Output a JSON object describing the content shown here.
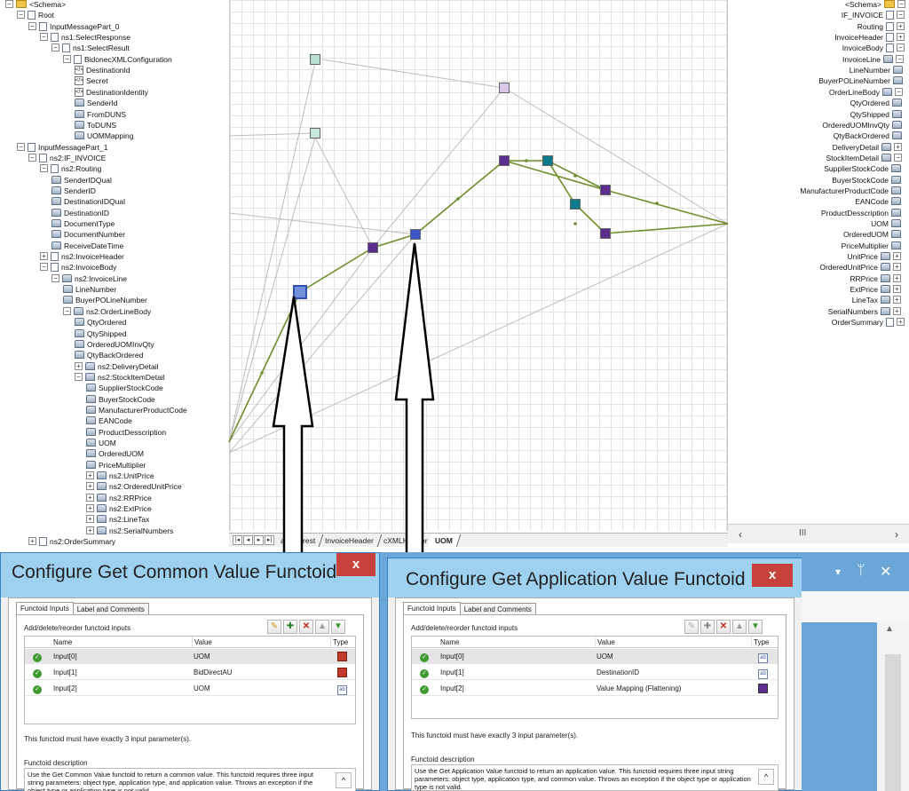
{
  "mapper": {
    "source_tree": [
      {
        "label": "<Schema>",
        "icon": "folder-icon",
        "exp": "−"
      },
      {
        "label": "Root",
        "icon": "record-icon",
        "exp": "−"
      },
      {
        "label": "InputMessagePart_0",
        "icon": "record-icon",
        "exp": "−"
      },
      {
        "label": "ns1:SelectResponse",
        "icon": "record-icon",
        "exp": "−"
      },
      {
        "label": "ns1:SelectResult",
        "icon": "record-icon",
        "exp": "−"
      },
      {
        "label": "BidonecXMLConfiguration",
        "icon": "record-icon",
        "exp": "−"
      },
      {
        "label": "DestinationId",
        "icon": "attribute-icon",
        "exp": ""
      },
      {
        "label": "Secret",
        "icon": "attribute-icon",
        "exp": ""
      },
      {
        "label": "DestinationIdentity",
        "icon": "attribute-icon",
        "exp": ""
      },
      {
        "label": "SenderId",
        "icon": "element-icon",
        "exp": ""
      },
      {
        "label": "FromDUNS",
        "icon": "element-icon",
        "exp": ""
      },
      {
        "label": "ToDUNS",
        "icon": "element-icon",
        "exp": ""
      },
      {
        "label": "UOMMapping",
        "icon": "element-icon",
        "exp": ""
      },
      {
        "label": "InputMessagePart_1",
        "icon": "record-icon",
        "exp": "−"
      },
      {
        "label": "ns2:IF_INVOICE",
        "icon": "record-icon",
        "exp": "−"
      },
      {
        "label": "ns2:Routing",
        "icon": "record-icon",
        "exp": "−"
      },
      {
        "label": "SenderIDQual",
        "icon": "element-icon",
        "exp": ""
      },
      {
        "label": "SenderID",
        "icon": "element-icon",
        "exp": ""
      },
      {
        "label": "DestinationIDQual",
        "icon": "element-icon",
        "exp": ""
      },
      {
        "label": "DestinationID",
        "icon": "element-icon",
        "exp": ""
      },
      {
        "label": "DocumentType",
        "icon": "element-icon",
        "exp": ""
      },
      {
        "label": "DocumentNumber",
        "icon": "element-icon",
        "exp": ""
      },
      {
        "label": "ReceiveDateTime",
        "icon": "element-icon",
        "exp": ""
      },
      {
        "label": "ns2:InvoiceHeader",
        "icon": "record-icon",
        "exp": "+"
      },
      {
        "label": "ns2:InvoiceBody",
        "icon": "record-icon",
        "exp": "−"
      },
      {
        "label": "ns2:InvoiceLine",
        "icon": "element-icon",
        "exp": "−"
      },
      {
        "label": "LineNumber",
        "icon": "element-icon",
        "exp": ""
      },
      {
        "label": "BuyerPOLineNumber",
        "icon": "element-icon",
        "exp": ""
      },
      {
        "label": "ns2:OrderLineBody",
        "icon": "element-icon",
        "exp": "−"
      },
      {
        "label": "QtyOrdered",
        "icon": "element-icon",
        "exp": ""
      },
      {
        "label": "QtyShipped",
        "icon": "element-icon",
        "exp": ""
      },
      {
        "label": "OrderedUOMInvQty",
        "icon": "element-icon",
        "exp": ""
      },
      {
        "label": "QtyBackOrdered",
        "icon": "element-icon",
        "exp": ""
      },
      {
        "label": "ns2:DeliveryDetail",
        "icon": "element-icon",
        "exp": "+"
      },
      {
        "label": "ns2:StockItemDetail",
        "icon": "element-icon",
        "exp": "−"
      },
      {
        "label": "SupplierStockCode",
        "icon": "element-icon",
        "exp": ""
      },
      {
        "label": "BuyerStockCode",
        "icon": "element-icon",
        "exp": ""
      },
      {
        "label": "ManufacturerProductCode",
        "icon": "element-icon",
        "exp": ""
      },
      {
        "label": "EANCode",
        "icon": "element-icon",
        "exp": ""
      },
      {
        "label": "ProductDesscription",
        "icon": "element-icon",
        "exp": ""
      },
      {
        "label": "UOM",
        "icon": "element-icon",
        "exp": ""
      },
      {
        "label": "OrderedUOM",
        "icon": "element-icon",
        "exp": ""
      },
      {
        "label": "PriceMultiplier",
        "icon": "element-icon",
        "exp": ""
      },
      {
        "label": "ns2:UnitPrice",
        "icon": "element-icon",
        "exp": "+"
      },
      {
        "label": "ns2:OrderedUnitPrice",
        "icon": "element-icon",
        "exp": "+"
      },
      {
        "label": "ns2:RRPrice",
        "icon": "element-icon",
        "exp": "+"
      },
      {
        "label": "ns2:ExtPrice",
        "icon": "element-icon",
        "exp": "+"
      },
      {
        "label": "ns2:LineTax",
        "icon": "element-icon",
        "exp": "+"
      },
      {
        "label": "ns2:SerialNumbers",
        "icon": "element-icon",
        "exp": "+"
      },
      {
        "label": "ns2:OrderSummary",
        "icon": "record-icon",
        "exp": "+"
      }
    ],
    "target_tree": [
      {
        "label": "<Schema>",
        "icon": "folder-icon",
        "exp": "−"
      },
      {
        "label": "IF_INVOICE",
        "icon": "record-icon",
        "exp": "−"
      },
      {
        "label": "Routing",
        "icon": "record-icon",
        "exp": "+"
      },
      {
        "label": "InvoiceHeader",
        "icon": "record-icon",
        "exp": "+"
      },
      {
        "label": "InvoiceBody",
        "icon": "record-icon",
        "exp": "−"
      },
      {
        "label": "InvoiceLine",
        "icon": "element-icon",
        "exp": "−"
      },
      {
        "label": "LineNumber",
        "icon": "element-icon",
        "exp": ""
      },
      {
        "label": "BuyerPOLineNumber",
        "icon": "element-icon",
        "exp": ""
      },
      {
        "label": "OrderLineBody",
        "icon": "element-icon",
        "exp": "−"
      },
      {
        "label": "QtyOrdered",
        "icon": "element-icon",
        "exp": ""
      },
      {
        "label": "QtyShipped",
        "icon": "element-icon",
        "exp": ""
      },
      {
        "label": "OrderedUOMInvQty",
        "icon": "element-icon",
        "exp": ""
      },
      {
        "label": "QtyBackOrdered",
        "icon": "element-icon",
        "exp": ""
      },
      {
        "label": "DeliveryDetail",
        "icon": "element-icon",
        "exp": "+"
      },
      {
        "label": "StockItemDetail",
        "icon": "element-icon",
        "exp": "−"
      },
      {
        "label": "SupplierStockCode",
        "icon": "element-icon",
        "exp": ""
      },
      {
        "label": "BuyerStockCode",
        "icon": "element-icon",
        "exp": ""
      },
      {
        "label": "ManufacturerProductCode",
        "icon": "element-icon",
        "exp": ""
      },
      {
        "label": "EANCode",
        "icon": "element-icon",
        "exp": ""
      },
      {
        "label": "ProductDesscription",
        "icon": "element-icon",
        "exp": ""
      },
      {
        "label": "UOM",
        "icon": "element-icon",
        "exp": ""
      },
      {
        "label": "OrderedUOM",
        "icon": "element-icon",
        "exp": ""
      },
      {
        "label": "PriceMultiplier",
        "icon": "element-icon",
        "exp": ""
      },
      {
        "label": "UnitPrice",
        "icon": "element-icon",
        "exp": "+"
      },
      {
        "label": "OrderedUnitPrice",
        "icon": "element-icon",
        "exp": "+"
      },
      {
        "label": "RRPrice",
        "icon": "element-icon",
        "exp": "+"
      },
      {
        "label": "ExtPrice",
        "icon": "element-icon",
        "exp": "+"
      },
      {
        "label": "LineTax",
        "icon": "element-icon",
        "exp": "+"
      },
      {
        "label": "SerialNumbers",
        "icon": "element-icon",
        "exp": "+"
      },
      {
        "label": "OrderSummary",
        "icon": "record-icon",
        "exp": "+"
      }
    ],
    "page_tabs": [
      {
        "label": "all the rest",
        "active": false
      },
      {
        "label": "InvoiceHeader",
        "active": false
      },
      {
        "label": "cXMLHeader",
        "active": false
      },
      {
        "label": "UOM",
        "active": true
      }
    ],
    "hscroll_thumb": "III",
    "colors": {
      "link_active": "#6e8e2b",
      "link_inactive": "#bdbdbd",
      "grid": "#e3e3e3"
    }
  },
  "dialog_common": {
    "title": "Configure Get Common Value Functoid",
    "close": "x",
    "tabs": [
      "Functoid Inputs",
      "Label and Comments"
    ],
    "section": "Add/delete/reorder functoid inputs",
    "columns": [
      "Name",
      "Value",
      "Type"
    ],
    "rows": [
      {
        "name": "Input[0]",
        "value": "UOM",
        "type": "red-link-icon"
      },
      {
        "name": "Input[1]",
        "value": "BidDirectAU",
        "type": "red-link-icon"
      },
      {
        "name": "Input[2]",
        "value": "UOM",
        "type": "constant-icon"
      }
    ],
    "param_note": "This functoid must have exactly 3 input parameter(s).",
    "desc_label": "Functoid description",
    "description": "Use the Get Common Value functoid to return a common value. This functoid requires three input string parameters: object type, application type, and application value. Throws an exception if the object type or application type is not valid."
  },
  "dialog_app": {
    "title": "Configure Get Application Value Functoid",
    "close": "x",
    "tabs": [
      "Functoid Inputs",
      "Label and Comments"
    ],
    "section": "Add/delete/reorder functoid inputs",
    "columns": [
      "Name",
      "Value",
      "Type"
    ],
    "rows": [
      {
        "name": "Input[0]",
        "value": "UOM",
        "type": "constant-icon"
      },
      {
        "name": "Input[1]",
        "value": "DestinationID",
        "type": "constant-icon"
      },
      {
        "name": "Input[2]",
        "value": "Value Mapping (Flattening)",
        "type": "functoid-link-icon"
      }
    ],
    "param_note": "This functoid must have exactly 3 input parameter(s).",
    "desc_label": "Functoid description",
    "description": "Use the Get Application Value functoid to return an application value. This functoid requires three input string parameters: object type, application type, and common value. Throws an exception if the object type or application type is not valid."
  },
  "dock": {
    "dropdown": "▾",
    "pin": "ᛘ",
    "close": "✕"
  }
}
